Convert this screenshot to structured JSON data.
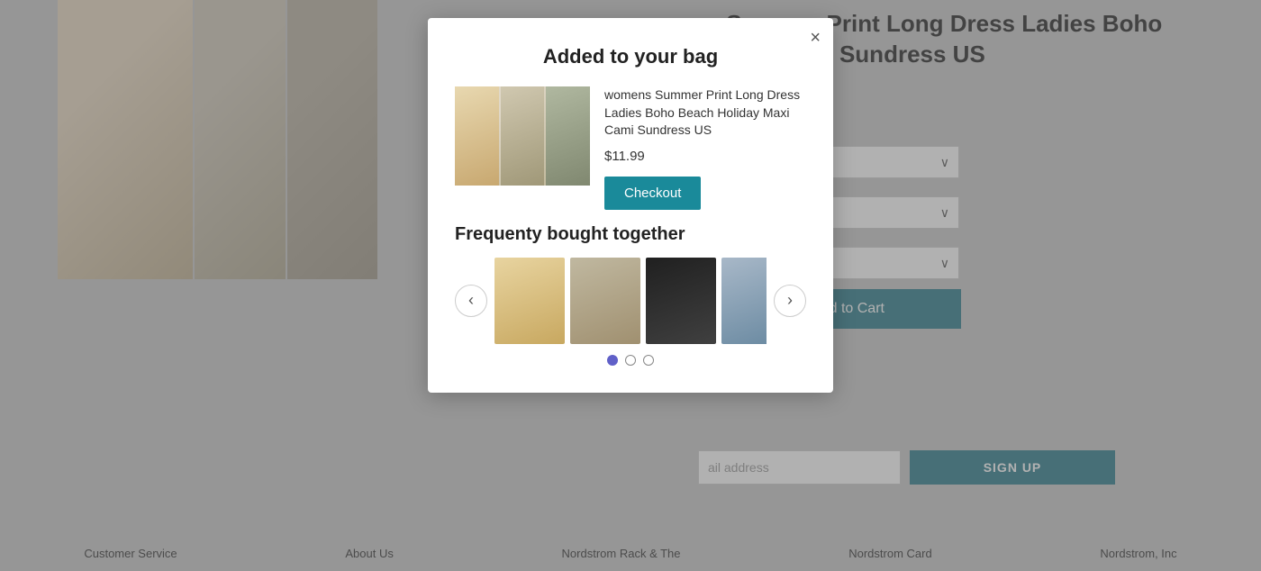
{
  "page": {
    "background_color": "#c8c8c8"
  },
  "product": {
    "title": "womens Summer Print Long Dress Ladies Boho Holiday Maxi Cami Sundress US",
    "dropdowns": [
      {
        "label": "",
        "placeholder": ""
      },
      {
        "label": "",
        "placeholder": ""
      },
      {
        "label": "",
        "placeholder": ""
      }
    ],
    "add_to_cart_label": "Add to Cart"
  },
  "email_signup": {
    "placeholder": "ail address",
    "button_label": "SIGN UP"
  },
  "footer": {
    "links": [
      "Customer Service",
      "About Us",
      "Nordstrom Rack & The",
      "Nordstrom Card",
      "Nordstrom, Inc"
    ]
  },
  "modal": {
    "title": "Added to your bag",
    "close_label": "×",
    "product_name": "womens Summer Print Long Dress Ladies Boho Beach Holiday Maxi Cami Sundress US",
    "product_price": "$11.99",
    "checkout_label": "Checkout",
    "frequently_title": "Frequenty bought together",
    "carousel": {
      "prev_label": "‹",
      "next_label": "›",
      "dots": [
        {
          "state": "active"
        },
        {
          "state": "inactive"
        },
        {
          "state": "inactive"
        }
      ]
    }
  }
}
